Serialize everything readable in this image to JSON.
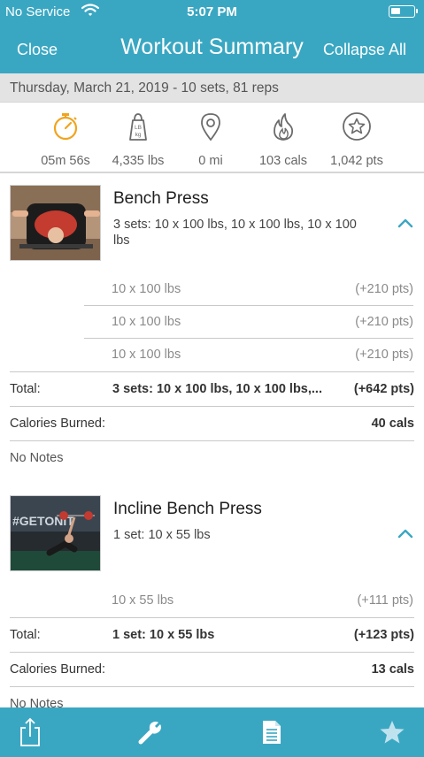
{
  "status": {
    "carrier": "No Service",
    "time": "5:07 PM"
  },
  "nav": {
    "close": "Close",
    "title": "Workout Summary",
    "collapse": "Collapse All"
  },
  "date_line": "Thursday, March 21, 2019 - 10 sets, 81 reps",
  "stats": [
    {
      "icon": "stopwatch-icon",
      "value": "05m 56s"
    },
    {
      "icon": "weight-icon",
      "value": "4,335 lbs"
    },
    {
      "icon": "location-pin-icon",
      "value": "0 mi"
    },
    {
      "icon": "flame-icon",
      "value": "103 cals"
    },
    {
      "icon": "star-badge-icon",
      "value": "1,042 pts"
    }
  ],
  "weight_icon_text": {
    "top": "LB",
    "bottom": "kg"
  },
  "exercises": [
    {
      "name": "Bench Press",
      "summary": "3 sets: 10 x 100 lbs, 10 x 100 lbs, 10 x 100 lbs",
      "sets": [
        {
          "value": "10 x 100 lbs",
          "points": "(+210 pts)"
        },
        {
          "value": "10 x 100 lbs",
          "points": "(+210 pts)"
        },
        {
          "value": "10 x 100 lbs",
          "points": "(+210 pts)"
        }
      ],
      "total_label": "Total:",
      "total_value": "3 sets: 10 x 100 lbs, 10 x 100 lbs,...",
      "total_points": "(+642 pts)",
      "calories_label": "Calories Burned:",
      "calories_value": "40 cals",
      "notes": "No Notes"
    },
    {
      "name": "Incline Bench Press",
      "summary": "1 set: 10 x 55 lbs",
      "thumb_text": "#GETONIT",
      "sets": [
        {
          "value": "10 x 55 lbs",
          "points": "(+111 pts)"
        }
      ],
      "total_label": "Total:",
      "total_value": "1 set: 10 x 55 lbs",
      "total_points": "(+123 pts)",
      "calories_label": "Calories Burned:",
      "calories_value": "13 cals",
      "notes": "No Notes"
    }
  ],
  "tabs": [
    {
      "icon": "share-icon"
    },
    {
      "icon": "wrench-icon"
    },
    {
      "icon": "document-icon"
    },
    {
      "icon": "star-icon"
    }
  ],
  "colors": {
    "accent": "#3aa7c2",
    "stopwatch": "#f0a41e",
    "icon_gray": "#6b6b6b"
  }
}
